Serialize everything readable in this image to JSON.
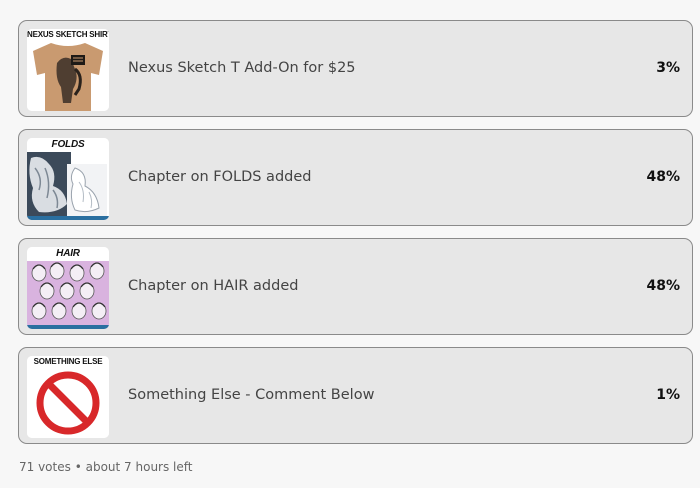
{
  "options": [
    {
      "label": "Nexus Sketch T Add-On for $25",
      "percent": "3%",
      "thumb_caption": "NEXUS SKETCH SHIRT",
      "thumb_icon": "tshirt-image-icon"
    },
    {
      "label": "Chapter on FOLDS added",
      "percent": "48%",
      "thumb_caption": "FOLDS",
      "thumb_icon": "folds-sculpture-image-icon"
    },
    {
      "label": "Chapter on HAIR added",
      "percent": "48%",
      "thumb_caption": "HAIR",
      "thumb_icon": "hair-sketches-image-icon"
    },
    {
      "label": "Something Else - Comment Below",
      "percent": "1%",
      "thumb_caption": "SOMETHING ELSE",
      "thumb_icon": "prohibited-sign-icon"
    }
  ],
  "footer": {
    "votes": "71 votes",
    "separator": "•",
    "time_left": "about 7 hours left"
  },
  "colors": {
    "card_bg": "#e7e7e7",
    "card_border": "#8a8a8a",
    "prohibited_red": "#d8282a"
  }
}
